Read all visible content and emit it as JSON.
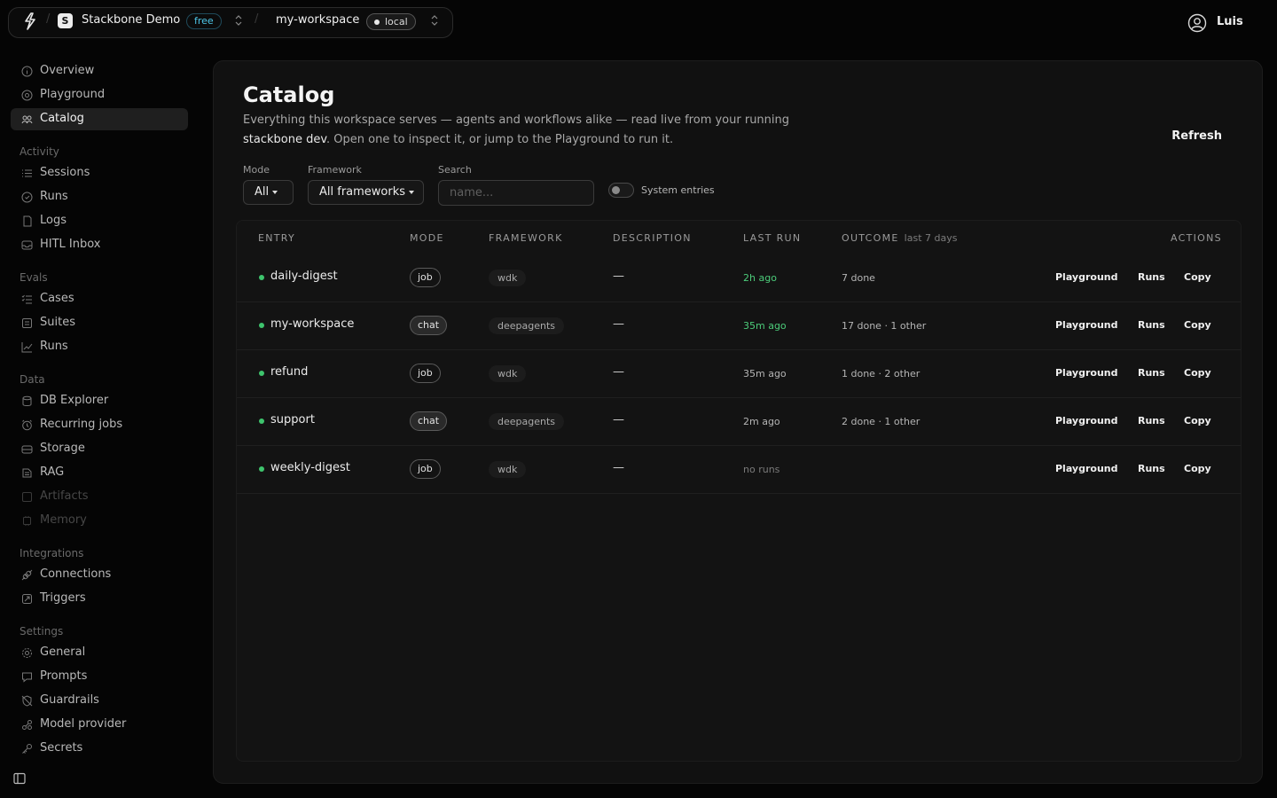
{
  "topbar": {
    "org_name": "Stackbone Demo",
    "org_initial": "S",
    "plan_badge": "free",
    "workspace_name": "my-workspace",
    "env_badge": "local",
    "user_name": "Luis"
  },
  "sidebar": {
    "items": [
      {
        "label": "Overview",
        "icon": "info-icon"
      },
      {
        "label": "Playground",
        "icon": "playground-icon"
      },
      {
        "label": "Catalog",
        "icon": "catalog-icon",
        "active": true
      }
    ],
    "sections": [
      {
        "title": "Activity",
        "items": [
          {
            "label": "Sessions",
            "icon": "list-icon"
          },
          {
            "label": "Runs",
            "icon": "clock-icon"
          },
          {
            "label": "Logs",
            "icon": "logs-icon"
          },
          {
            "label": "HITL Inbox",
            "icon": "inbox-icon"
          }
        ]
      },
      {
        "title": "Evals",
        "items": [
          {
            "label": "Cases",
            "icon": "checklist-icon"
          },
          {
            "label": "Suites",
            "icon": "suites-icon"
          },
          {
            "label": "Runs",
            "icon": "chart-icon"
          }
        ]
      },
      {
        "title": "Data",
        "items": [
          {
            "label": "DB Explorer",
            "icon": "database-icon"
          },
          {
            "label": "Recurring jobs",
            "icon": "alarm-icon"
          },
          {
            "label": "Storage",
            "icon": "storage-icon"
          },
          {
            "label": "RAG",
            "icon": "rag-icon"
          },
          {
            "label": "Artifacts",
            "icon": "artifacts-icon",
            "disabled": true
          },
          {
            "label": "Memory",
            "icon": "memory-icon",
            "disabled": true
          }
        ]
      },
      {
        "title": "Integrations",
        "items": [
          {
            "label": "Connections",
            "icon": "plug-icon"
          },
          {
            "label": "Triggers",
            "icon": "trigger-icon"
          }
        ]
      },
      {
        "title": "Settings",
        "items": [
          {
            "label": "General",
            "icon": "gear-icon"
          },
          {
            "label": "Prompts",
            "icon": "prompt-icon"
          },
          {
            "label": "Guardrails",
            "icon": "shield-off-icon"
          },
          {
            "label": "Model provider",
            "icon": "model-icon"
          },
          {
            "label": "Secrets",
            "icon": "key-icon"
          }
        ]
      }
    ]
  },
  "page": {
    "title": "Catalog",
    "description_pre": "Everything this workspace serves — agents and workflows alike — read live from your running ",
    "description_code": "stackbone dev",
    "description_post": ". Open one to inspect it, or jump to the Playground to run it.",
    "refresh_label": "Refresh"
  },
  "filters": {
    "mode_label": "Mode",
    "mode_value": "All",
    "framework_label": "Framework",
    "framework_value": "All frameworks",
    "search_label": "Search",
    "search_placeholder": "name...",
    "system_toggle_label": "System entries",
    "system_toggle_on": false
  },
  "table": {
    "headers": {
      "entry": "ENTRY",
      "mode": "MODE",
      "framework": "FRAMEWORK",
      "description": "DESCRIPTION",
      "last_run": "LAST RUN",
      "outcome": "OUTCOME",
      "outcome_sub": "last 7 days",
      "actions": "ACTIONS"
    },
    "action_labels": [
      "Playground",
      "Runs",
      "Copy"
    ],
    "rows": [
      {
        "name": "daily-digest",
        "mode": "job",
        "framework": "wdk",
        "description": "—",
        "last_run": "2h ago",
        "last_run_state": "recent",
        "outcome": "7 done"
      },
      {
        "name": "my-workspace",
        "mode": "chat",
        "framework": "deepagents",
        "description": "—",
        "last_run": "35m ago",
        "last_run_state": "recent",
        "outcome": "17 done · 1 other"
      },
      {
        "name": "refund",
        "mode": "job",
        "framework": "wdk",
        "description": "—",
        "last_run": "35m ago",
        "last_run_state": "normal",
        "outcome": "1 done · 2 other"
      },
      {
        "name": "support",
        "mode": "chat",
        "framework": "deepagents",
        "description": "—",
        "last_run": "2m ago",
        "last_run_state": "normal",
        "outcome": "2 done · 1 other"
      },
      {
        "name": "weekly-digest",
        "mode": "job",
        "framework": "wdk",
        "description": "—",
        "last_run": "no runs",
        "last_run_state": "none",
        "outcome": ""
      }
    ]
  },
  "colors": {
    "accent_green": "#3ec46d",
    "badge_cyan": "#4ec7e8",
    "background": "#050505",
    "card": "#111111"
  }
}
